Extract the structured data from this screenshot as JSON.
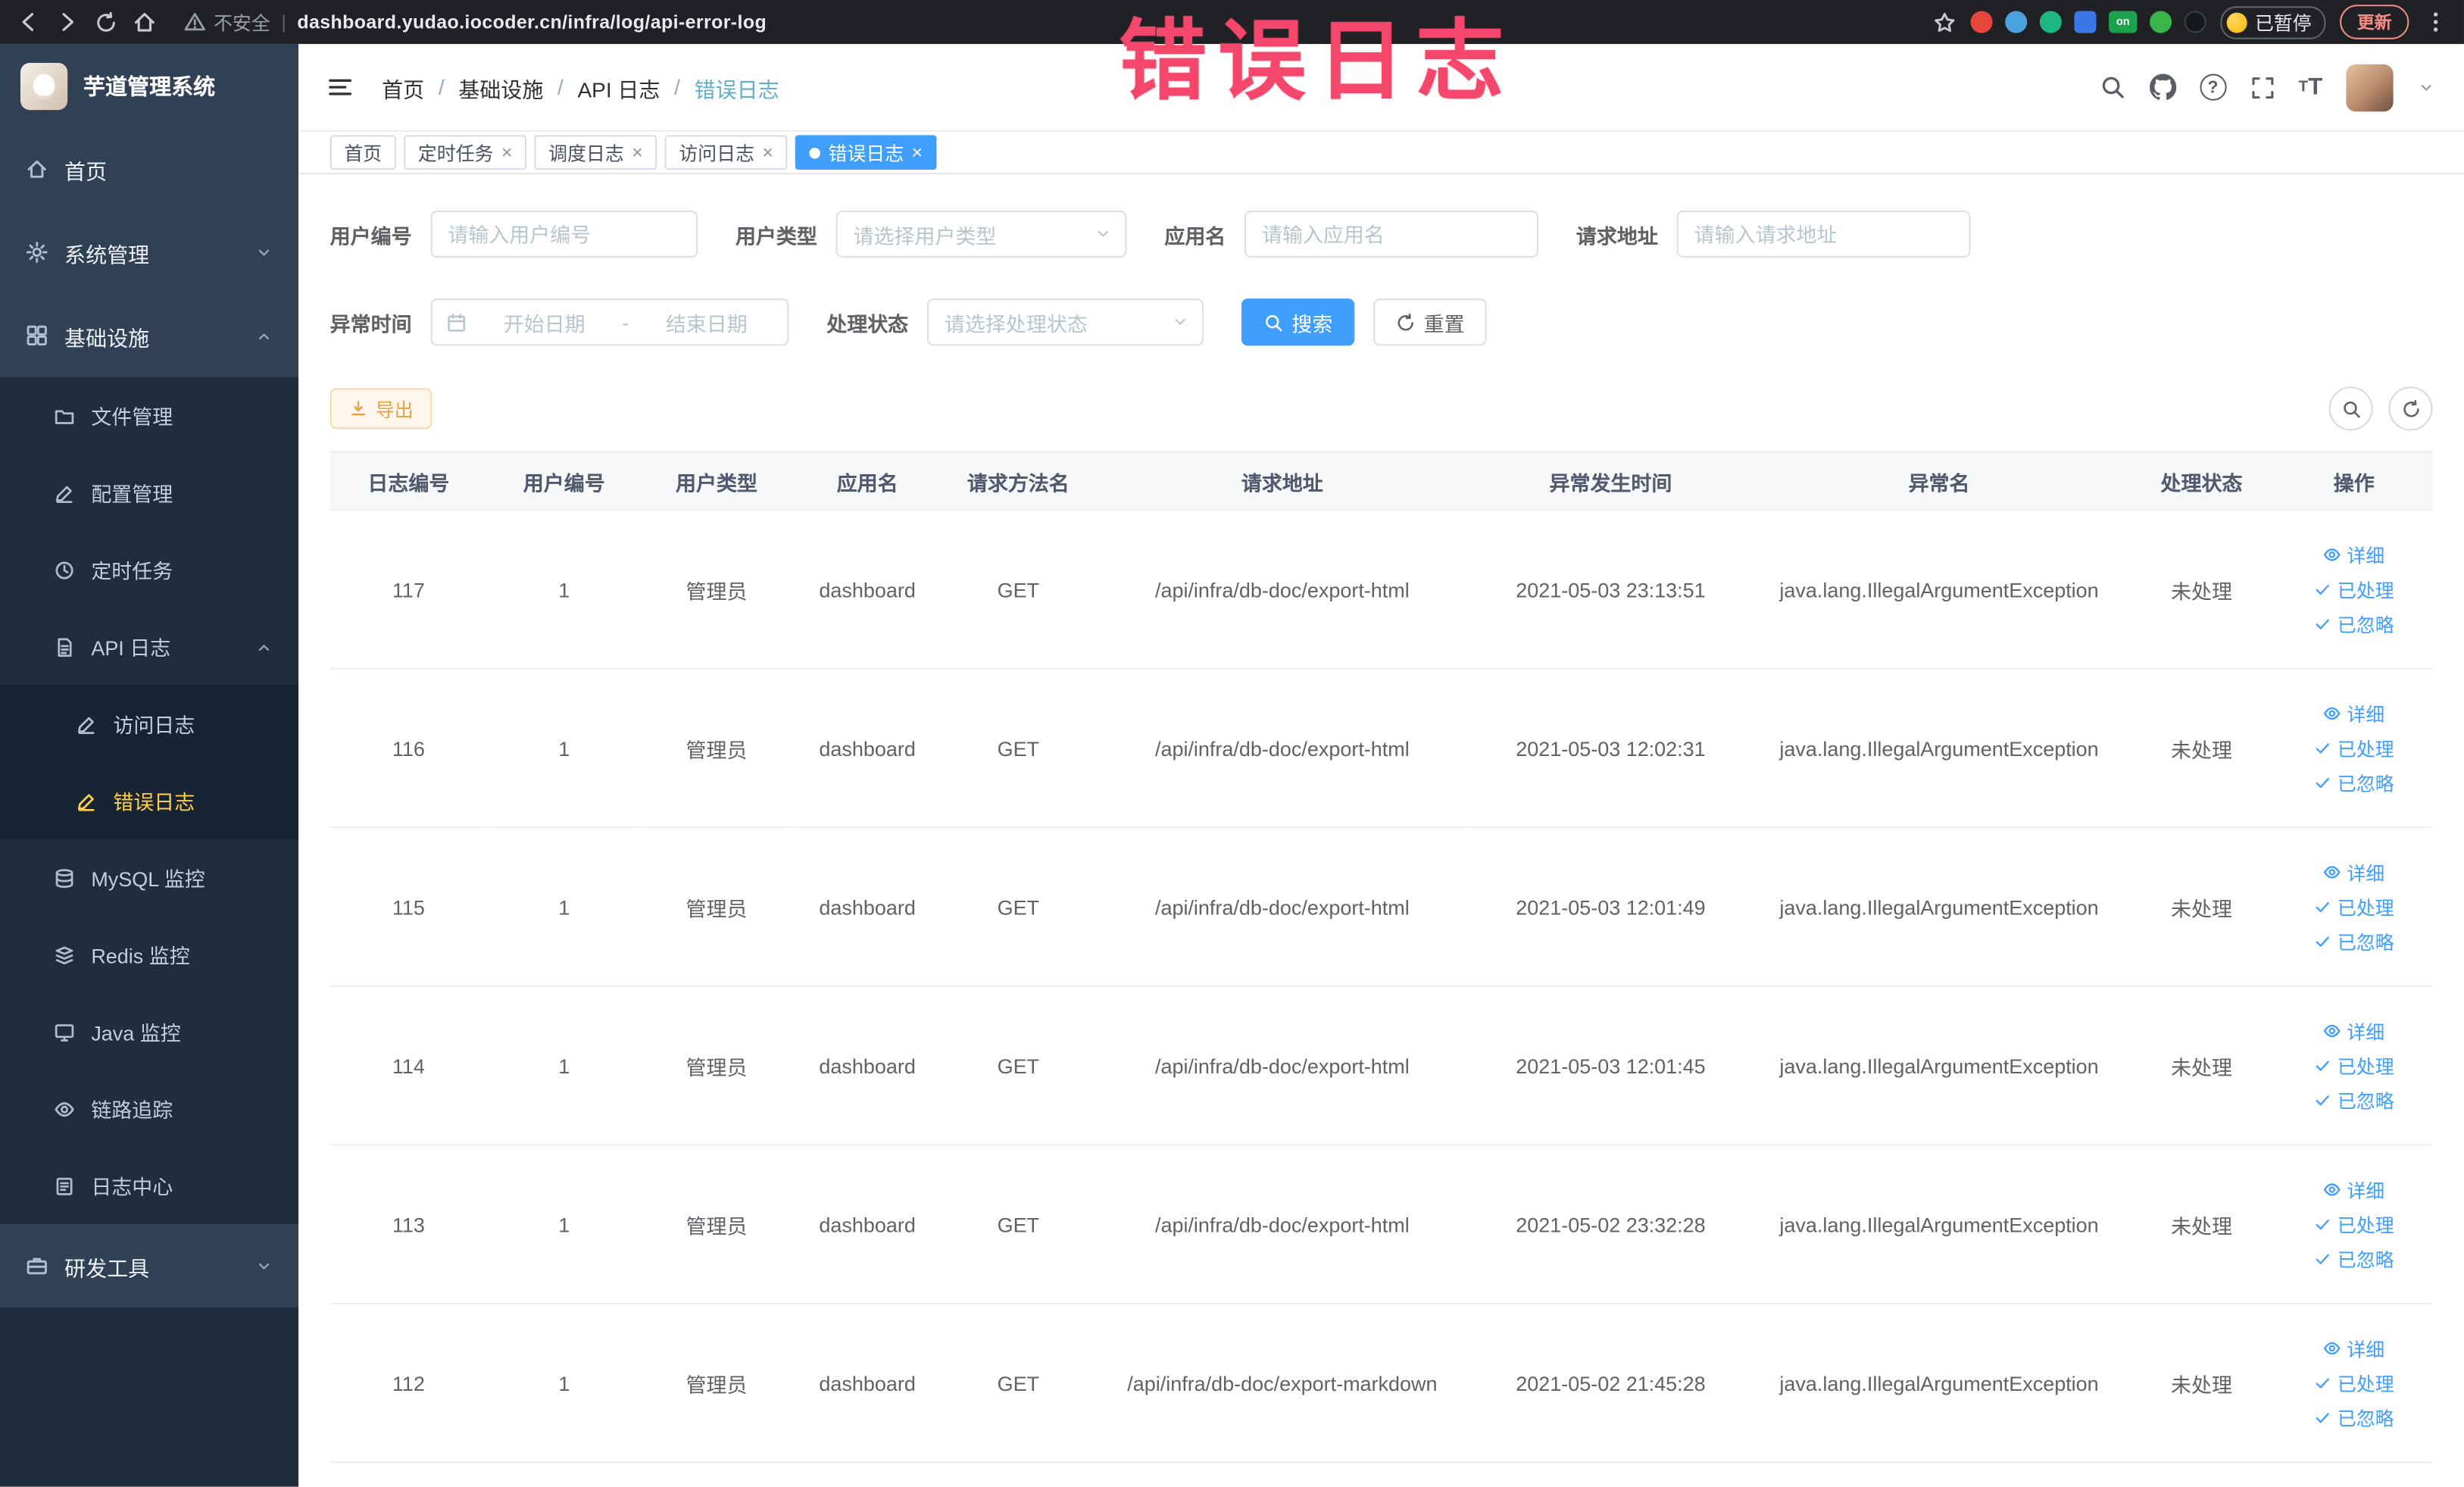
{
  "browser": {
    "security_label": "不安全",
    "divider": "|",
    "url": "dashboard.yudao.iocoder.cn/infra/log/api-error-log",
    "on_badge": "on",
    "paused_badge": "已暂停",
    "update_button": "更新"
  },
  "annotation": {
    "text": "错误日志",
    "color": "#f5476b"
  },
  "glyphs": {
    "slash": "/",
    "close": "×",
    "question": "?",
    "t_large": "T",
    "t_small": "T"
  },
  "sidebar": {
    "logo_title": "芋道管理系统",
    "home": "首页",
    "system": "系统管理",
    "infra": "基础设施",
    "infra_children": {
      "file": "文件管理",
      "config": "配置管理",
      "job": "定时任务",
      "api_log": "API 日志",
      "access_log": "访问日志",
      "error_log": "错误日志",
      "mysql": "MySQL 监控",
      "redis": "Redis 监控",
      "java": "Java 监控",
      "trace": "链路追踪",
      "log_center": "日志中心"
    },
    "dev_tools": "研发工具"
  },
  "breadcrumb": {
    "items": [
      "首页",
      "基础设施",
      "API 日志",
      "错误日志"
    ],
    "separator": "/"
  },
  "tabs": [
    {
      "label": "首页",
      "closable": false,
      "active": false
    },
    {
      "label": "定时任务",
      "closable": true,
      "active": false
    },
    {
      "label": "调度日志",
      "closable": true,
      "active": false
    },
    {
      "label": "访问日志",
      "closable": true,
      "active": false
    },
    {
      "label": "错误日志",
      "closable": true,
      "active": true
    }
  ],
  "filters": {
    "user_id": {
      "label": "用户编号",
      "value": "",
      "placeholder": "请输入用户编号"
    },
    "user_type": {
      "label": "用户类型",
      "placeholder": "请选择用户类型"
    },
    "app_name": {
      "label": "应用名",
      "value": "",
      "placeholder": "请输入应用名"
    },
    "request_url": {
      "label": "请求地址",
      "value": "",
      "placeholder": "请输入请求地址"
    },
    "exception_time": {
      "label": "异常时间",
      "start_placeholder": "开始日期",
      "separator": "-",
      "end_placeholder": "结束日期"
    },
    "process_status": {
      "label": "处理状态",
      "placeholder": "请选择处理状态"
    },
    "search_button": "搜索",
    "reset_button": "重置"
  },
  "toolbar": {
    "export_button": "导出"
  },
  "table": {
    "columns": [
      "日志编号",
      "用户编号",
      "用户类型",
      "应用名",
      "请求方法名",
      "请求地址",
      "异常发生时间",
      "异常名",
      "处理状态",
      "操作"
    ],
    "actions": {
      "detail": "详细",
      "processed": "已处理",
      "ignored": "已忽略"
    },
    "rows": [
      {
        "id": "117",
        "user_id": "1",
        "user_type": "管理员",
        "app_name": "dashboard",
        "method": "GET",
        "url": "/api/infra/db-doc/export-html",
        "time": "2021-05-03 23:13:51",
        "exception": "java.lang.IllegalArgumentException",
        "status": "未处理"
      },
      {
        "id": "116",
        "user_id": "1",
        "user_type": "管理员",
        "app_name": "dashboard",
        "method": "GET",
        "url": "/api/infra/db-doc/export-html",
        "time": "2021-05-03 12:02:31",
        "exception": "java.lang.IllegalArgumentException",
        "status": "未处理"
      },
      {
        "id": "115",
        "user_id": "1",
        "user_type": "管理员",
        "app_name": "dashboard",
        "method": "GET",
        "url": "/api/infra/db-doc/export-html",
        "time": "2021-05-03 12:01:49",
        "exception": "java.lang.IllegalArgumentException",
        "status": "未处理"
      },
      {
        "id": "114",
        "user_id": "1",
        "user_type": "管理员",
        "app_name": "dashboard",
        "method": "GET",
        "url": "/api/infra/db-doc/export-html",
        "time": "2021-05-03 12:01:45",
        "exception": "java.lang.IllegalArgumentException",
        "status": "未处理"
      },
      {
        "id": "113",
        "user_id": "1",
        "user_type": "管理员",
        "app_name": "dashboard",
        "method": "GET",
        "url": "/api/infra/db-doc/export-html",
        "time": "2021-05-02 23:32:28",
        "exception": "java.lang.IllegalArgumentException",
        "status": "未处理"
      },
      {
        "id": "112",
        "user_id": "1",
        "user_type": "管理员",
        "app_name": "dashboard",
        "method": "GET",
        "url": "/api/infra/db-doc/export-markdown",
        "time": "2021-05-02 21:45:28",
        "exception": "java.lang.IllegalArgumentException",
        "status": "未处理"
      }
    ]
  }
}
